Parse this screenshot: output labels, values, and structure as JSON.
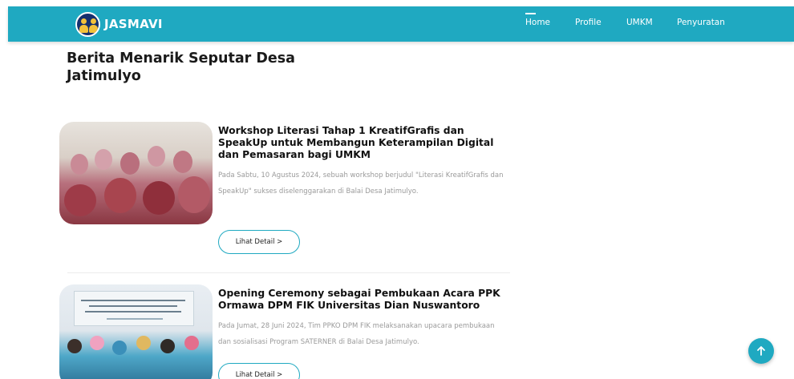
{
  "brand": {
    "name": "JASMAVI",
    "logo_icon": "village-logo-icon"
  },
  "nav": {
    "items": [
      {
        "label": "Home",
        "active": true
      },
      {
        "label": "Profile",
        "active": false
      },
      {
        "label": "UMKM",
        "active": false
      },
      {
        "label": "Penyuratan",
        "active": false
      }
    ]
  },
  "page": {
    "title": "Berita Menarik Seputar Desa Jatimulyo"
  },
  "articles": [
    {
      "title": "Workshop Literasi Tahap 1 KreatifGrafis dan SpeakUp untuk Membangun Keterampilan Digital dan Pemasaran bagi UMKM",
      "excerpt": "Pada Sabtu, 10 Agustus 2024, sebuah workshop berjudul \"Literasi KreatifGrafis dan SpeakUp\" sukses diselenggarakan di Balai Desa Jatimulyo.",
      "button_label": "Lihat Detail >"
    },
    {
      "title": "Opening Ceremony sebagai Pembukaan Acara PPK Ormawa DPM FIK Universitas Dian Nuswantoro",
      "excerpt": "Pada Jumat, 28 Juni 2024, Tim PPKO DPM FIK melaksanakan upacara pembukaan dan sosialisasi Program SATERNER di Balai Desa Jatimulyo.",
      "button_label": "Lihat Detail >"
    }
  ],
  "colors": {
    "accent": "#1fa9c1",
    "text": "#111111",
    "muted": "#9a9a9a"
  },
  "scroll_top_icon": "arrow-up-icon"
}
